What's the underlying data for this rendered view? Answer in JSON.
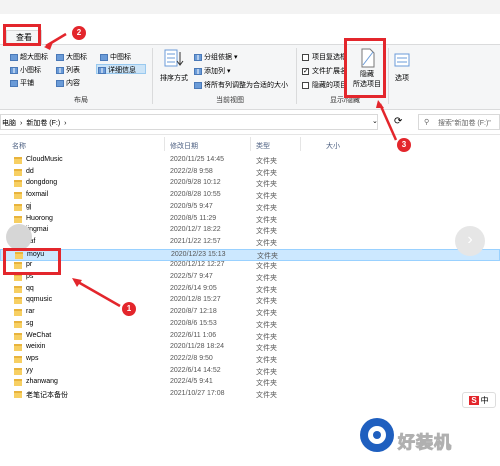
{
  "ribbon": {
    "tab_view": "查看",
    "layout": {
      "extra_large": "超大图标",
      "large": "大图标",
      "medium": "中图标",
      "small": "小图标",
      "list": "列表",
      "details": "详细信息",
      "tiles": "平铺",
      "content": "内容",
      "group_label": "布局"
    },
    "current_view": {
      "sort_by": "排序方式",
      "group_by": "分组依据",
      "add_columns": "添加列",
      "size_columns": "将所有列调整为合适的大小",
      "group_label": "当前视图"
    },
    "show_hide": {
      "item_checkboxes": "项目复选框",
      "file_extensions": "文件扩展名",
      "hidden_items": "隐藏的项目",
      "hide_selected_line1": "隐藏",
      "hide_selected_line2": "所选项目",
      "options": "选项",
      "group_label": "显示/隐藏"
    }
  },
  "address": {
    "path_part1": "电脑",
    "path_sep": "›",
    "path_part2": "新加卷 (F:)",
    "search_placeholder": "搜索\"新加卷 (F:)\""
  },
  "columns": {
    "name": "名称",
    "modified": "修改日期",
    "type": "类型",
    "size": "大小"
  },
  "files": [
    {
      "name": "CloudMusic",
      "date": "2020/11/25 14:45",
      "type": "文件夹"
    },
    {
      "name": "dd",
      "date": "2022/2/8 9:58",
      "type": "文件夹"
    },
    {
      "name": "dongdong",
      "date": "2020/9/28 10:12",
      "type": "文件夹"
    },
    {
      "name": "foxmail",
      "date": "2020/8/28 10:55",
      "type": "文件夹"
    },
    {
      "name": "gj",
      "date": "2020/9/5 9:47",
      "type": "文件夹"
    },
    {
      "name": "Huorong",
      "date": "2020/8/5 11:29",
      "type": "文件夹"
    },
    {
      "name": "jingmai",
      "date": "2020/12/7 18:22",
      "type": "文件夹"
    },
    {
      "name": "kaf",
      "date": "2021/1/22 12:57",
      "type": "文件夹"
    },
    {
      "name": "moyu",
      "date": "2020/12/23 15:13",
      "type": "文件夹"
    },
    {
      "name": "pr",
      "date": "2020/12/12 12:27",
      "type": "文件夹"
    },
    {
      "name": "ps",
      "date": "2022/5/7 9:47",
      "type": "文件夹"
    },
    {
      "name": "qq",
      "date": "2022/6/14 9:05",
      "type": "文件夹"
    },
    {
      "name": "qqmusic",
      "date": "2020/12/8 15:27",
      "type": "文件夹"
    },
    {
      "name": "rar",
      "date": "2020/8/7 12:18",
      "type": "文件夹"
    },
    {
      "name": "sg",
      "date": "2020/8/6 15:53",
      "type": "文件夹"
    },
    {
      "name": "WeChat",
      "date": "2022/6/11 1:06",
      "type": "文件夹"
    },
    {
      "name": "weixin",
      "date": "2020/11/28 18:24",
      "type": "文件夹"
    },
    {
      "name": "wps",
      "date": "2022/2/8 9:50",
      "type": "文件夹"
    },
    {
      "name": "yy",
      "date": "2022/6/14 14:52",
      "type": "文件夹"
    },
    {
      "name": "zhanwang",
      "date": "2022/4/5 9:41",
      "type": "文件夹"
    },
    {
      "name": "老笔记本备份",
      "date": "2021/10/27 17:08",
      "type": "文件夹"
    }
  ],
  "annotations": {
    "step1": "1",
    "step2": "2",
    "step3": "3"
  },
  "watermark": {
    "text": "好装机",
    "ime": "中"
  },
  "colors": {
    "accent": "#e3262c",
    "selection": "#cce8ff",
    "folder": "#f7cf62"
  }
}
